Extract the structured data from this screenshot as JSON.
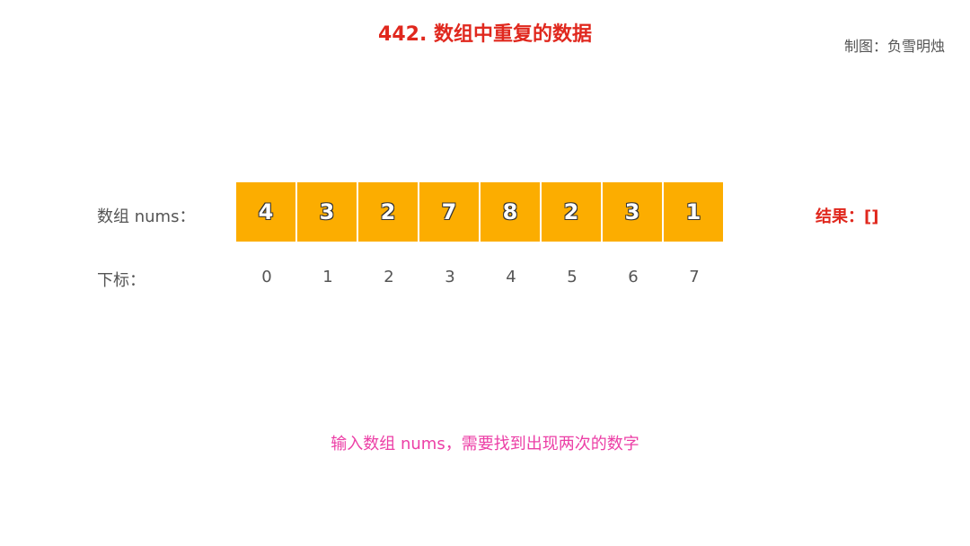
{
  "title": "442. 数组中重复的数据",
  "credit": "制图：负雪明烛",
  "array_label": "数组 nums：",
  "index_label": "下标：",
  "array": [
    {
      "value": "4"
    },
    {
      "value": "3"
    },
    {
      "value": "2"
    },
    {
      "value": "7"
    },
    {
      "value": "8"
    },
    {
      "value": "2"
    },
    {
      "value": "3"
    },
    {
      "value": "1"
    }
  ],
  "indices": [
    {
      "value": "0"
    },
    {
      "value": "1"
    },
    {
      "value": "2"
    },
    {
      "value": "3"
    },
    {
      "value": "4"
    },
    {
      "value": "5"
    },
    {
      "value": "6"
    },
    {
      "value": "7"
    }
  ],
  "result": "结果：[]",
  "caption": "输入数组 nums，需要找到出现两次的数字",
  "colors": {
    "title": "#e0281e",
    "cell_fill": "#fcad00",
    "result": "#e0281e",
    "caption": "#ec3fa6"
  }
}
